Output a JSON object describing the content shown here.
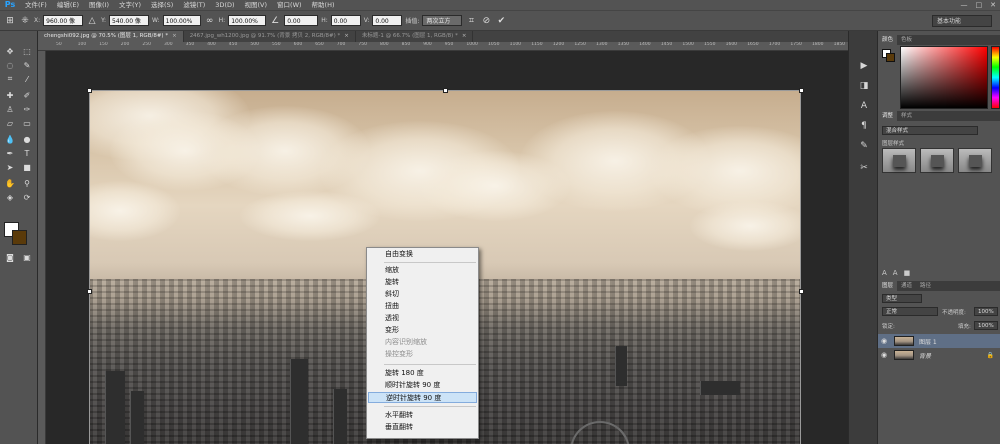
{
  "app": {
    "logo": "Ps",
    "menu": [
      "文件(F)",
      "编辑(E)",
      "图像(I)",
      "文字(Y)",
      "选择(S)",
      "滤镜(T)",
      "3D(D)",
      "视图(V)",
      "窗口(W)",
      "帮助(H)"
    ],
    "window_controls": [
      "—",
      "□",
      "✕"
    ]
  },
  "options_bar": {
    "x_label": "X:",
    "x_value": "960.00 像",
    "y_label": "Y:",
    "y_value": "540.00 像",
    "w_label": "W:",
    "w_value": "100.00%",
    "h_label": "H:",
    "h_value": "100.00%",
    "angle_value": "0.00",
    "hskew_label": "H:",
    "hskew_value": "0.00",
    "vskew_label": "V:",
    "vskew_value": "0.00",
    "interp_label": "插值:",
    "interp_value": "两次立方",
    "workspace": "基本功能"
  },
  "tabs": [
    {
      "label": "chengshi092.jpg @ 70.5% (图层 1, RGB/8#) *",
      "active": true
    },
    {
      "label": "2467.jpg_wh1200.jpg @ 91.7% (背景 拷贝 2, RGB/8#) *",
      "active": false
    },
    {
      "label": "未标题-1 @ 66.7% (图层 1, RGB/8) *",
      "active": false
    }
  ],
  "ruler_ticks": [
    "50",
    "100",
    "150",
    "200",
    "250",
    "300",
    "350",
    "400",
    "450",
    "500",
    "550",
    "600",
    "650",
    "700",
    "750",
    "800",
    "850",
    "900",
    "950",
    "1000",
    "1050",
    "1100",
    "1150",
    "1200",
    "1250",
    "1300",
    "1350",
    "1400",
    "1450",
    "1500",
    "1550",
    "1600",
    "1650",
    "1700",
    "1750",
    "1800",
    "1850"
  ],
  "context_menu": {
    "items": [
      {
        "label": "自由变换",
        "state": "normal"
      },
      {
        "label": "缩放",
        "state": "normal"
      },
      {
        "label": "旋转",
        "state": "normal"
      },
      {
        "label": "斜切",
        "state": "normal"
      },
      {
        "label": "扭曲",
        "state": "normal"
      },
      {
        "label": "透视",
        "state": "normal"
      },
      {
        "label": "变形",
        "state": "normal"
      },
      {
        "label": "内容识别缩放",
        "state": "disabled"
      },
      {
        "label": "操控变形",
        "state": "disabled"
      },
      {
        "label": "旋转 180 度",
        "state": "normal"
      },
      {
        "label": "顺时针旋转 90 度",
        "state": "normal"
      },
      {
        "label": "逆时针旋转 90 度",
        "state": "highlighted"
      },
      {
        "label": "水平翻转",
        "state": "normal"
      },
      {
        "label": "垂直翻转",
        "state": "normal"
      }
    ]
  },
  "panels": {
    "color_tabs": [
      "颜色",
      "色板"
    ],
    "adjust_tabs": [
      "调整",
      "样式"
    ],
    "style_dropdown": "混合样式",
    "style_label": "图层样式",
    "layers_tabs": [
      "图层",
      "通道",
      "路径"
    ],
    "kind_dropdown": "类型",
    "blend_mode": "正常",
    "opacity_label": "不透明度:",
    "opacity_value": "100%",
    "lock_label": "锁定:",
    "fill_label": "填充:",
    "fill_value": "100%",
    "layers": [
      {
        "name": "图层 1",
        "selected": true
      },
      {
        "name": "背景",
        "selected": false
      }
    ]
  },
  "colors": {
    "foreground": "#ffffff",
    "background": "#5a3a0a",
    "menu_highlight": "#cce3f7"
  }
}
